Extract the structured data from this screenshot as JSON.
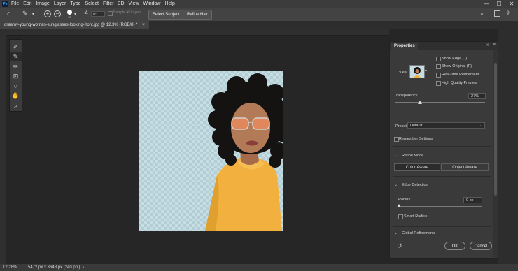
{
  "app": {
    "logo": "Ps"
  },
  "menu": {
    "items": [
      "File",
      "Edit",
      "Image",
      "Layer",
      "Type",
      "Select",
      "Filter",
      "3D",
      "View",
      "Window",
      "Help"
    ]
  },
  "window_controls": [
    "—",
    "☐",
    "✕"
  ],
  "options": {
    "size_value": "10",
    "angle_value": "0°",
    "sample_all_layers": "Sample All Layers",
    "select_subject": "Select Subject",
    "refine_hair": "Refine Hair"
  },
  "document": {
    "tab_title": "dreamy-young-woman-sunglasses-looking-front.jpg @ 12.3% (RGB/8) *",
    "close": "×"
  },
  "status": {
    "zoom": "12.28%",
    "dimensions": "5472 px x 3648 px (240 ppi)"
  },
  "properties": {
    "title": "Properties",
    "view_label": "View",
    "show_edge": "Show Edge (J)",
    "show_original": "Show Original (P)",
    "realtime_refinement": "Real-time Refinement",
    "high_quality_preview": "High Quality Preview",
    "transparency_label": "Transparency",
    "transparency_value": "27%",
    "transparency_level": 0.27,
    "preset_label": "Preset",
    "preset_value": "Default",
    "remember_settings": "Remember Settings",
    "refine_mode": "Refine Mode",
    "color_aware": "Color Aware",
    "object_aware": "Object Aware",
    "edge_detection": "Edge Detection",
    "radius_label": "Radius",
    "radius_value": "0 px",
    "smart_radius": "Smart Radius",
    "global_refinements": "Global Refinements",
    "ok": "OK",
    "cancel": "Cancel"
  },
  "colors": {
    "accent_sweater": "#f2b13e",
    "hair": "#151212",
    "checker_light": "#c6dde3",
    "checker_dark": "#b2cdd4"
  }
}
